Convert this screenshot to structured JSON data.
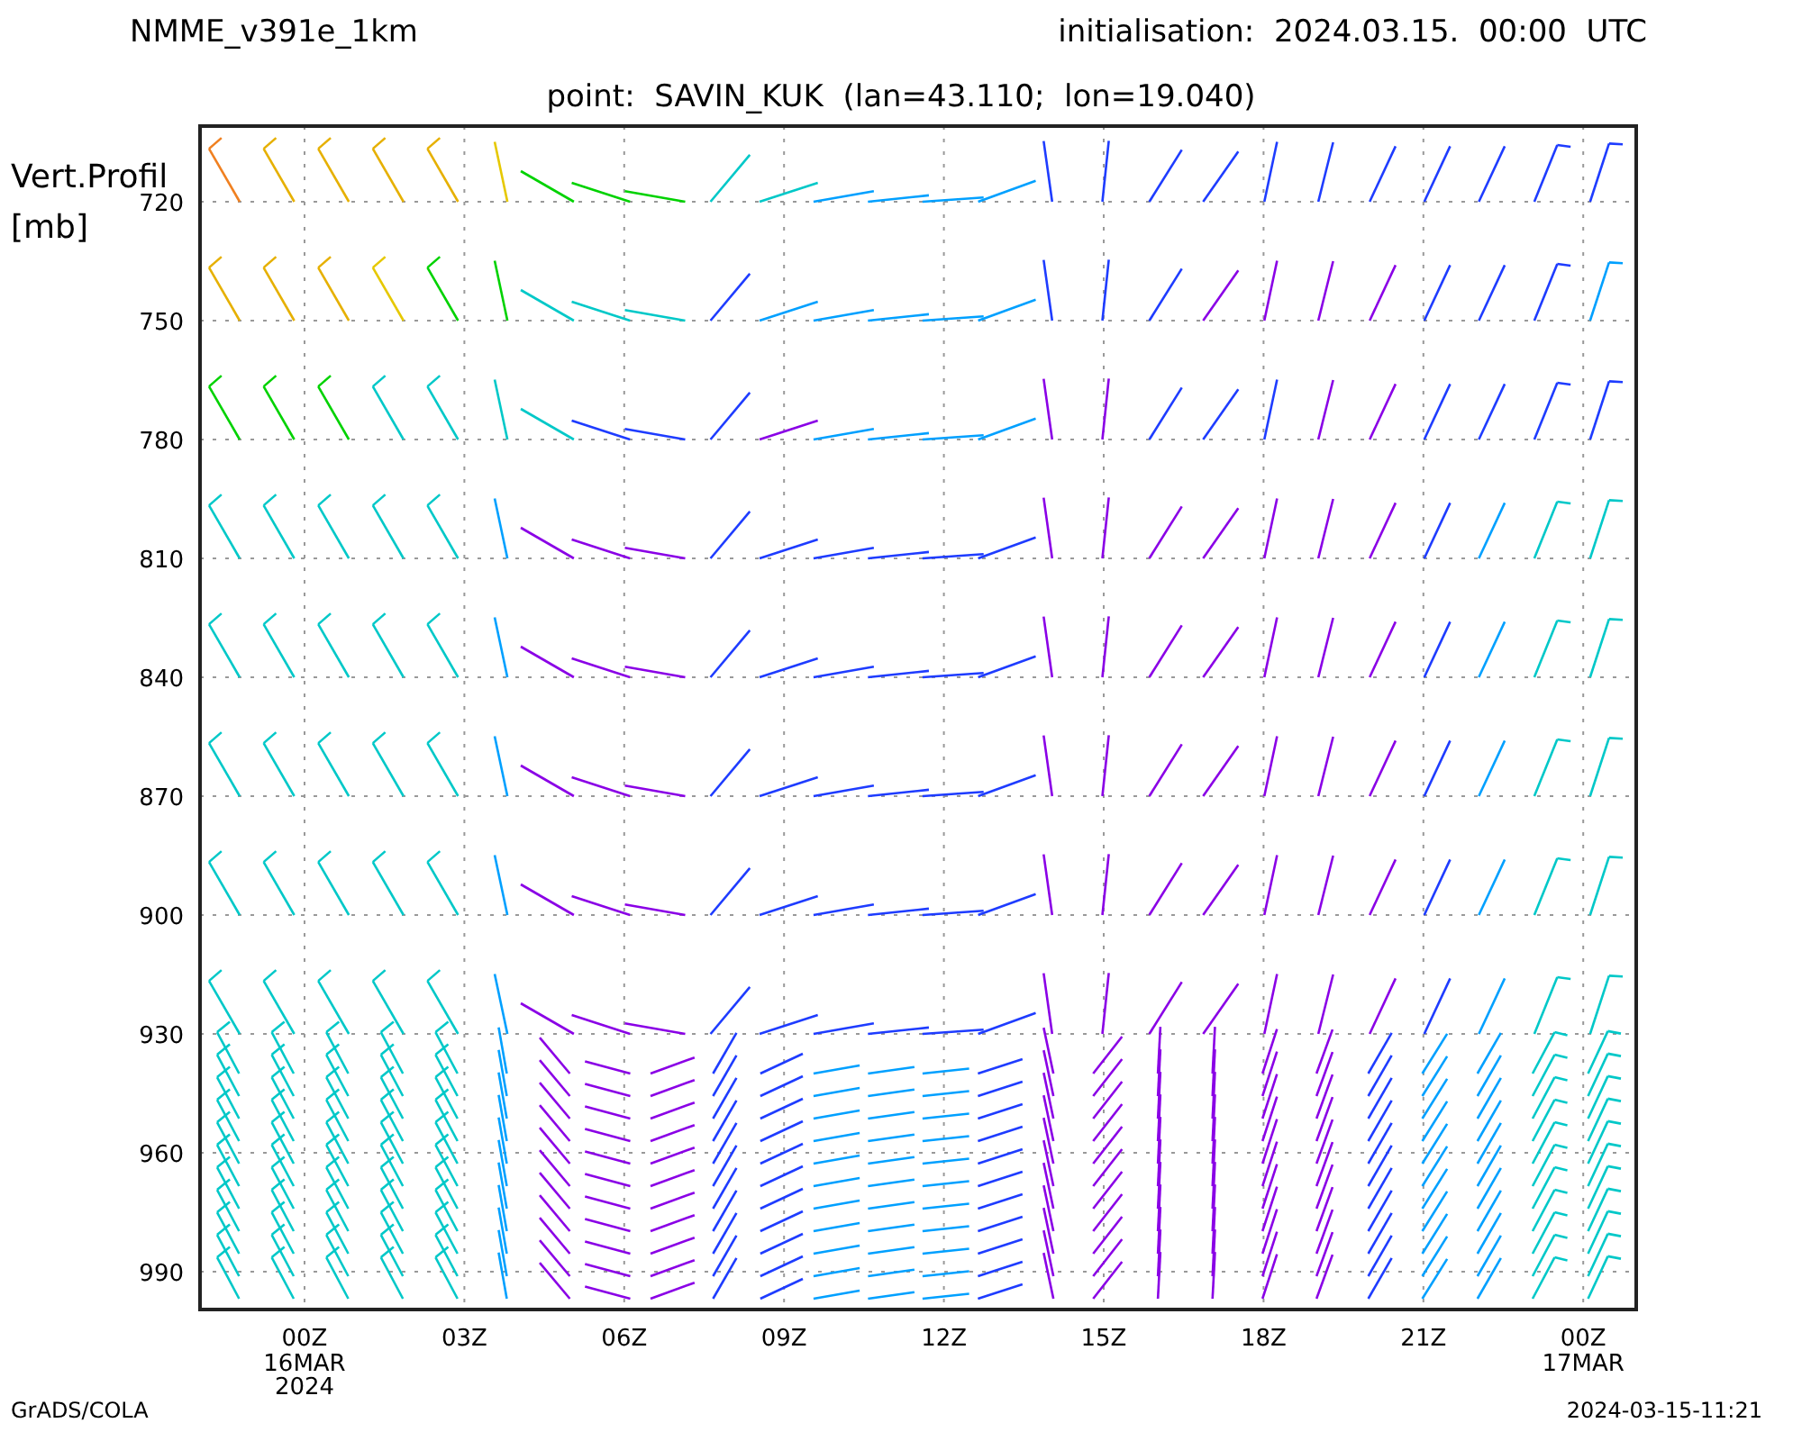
{
  "header": {
    "model": "NMME_v391e_1km",
    "initialisation": "initialisation:  2024.03.15.  00:00  UTC"
  },
  "subtitle": "point:  SAVIN_KUK  (lan=43.110;  lon=19.040)",
  "y_axis": {
    "title": [
      "Vert.Profil",
      "[mb]"
    ],
    "ticks": [
      "720",
      "750",
      "780",
      "810",
      "840",
      "870",
      "900",
      "930",
      "960",
      "990"
    ]
  },
  "x_axis": {
    "ticks": [
      {
        "label": "00Z",
        "sub": [
          "16MAR",
          "2024"
        ]
      },
      {
        "label": "03Z"
      },
      {
        "label": "06Z"
      },
      {
        "label": "09Z"
      },
      {
        "label": "12Z"
      },
      {
        "label": "15Z"
      },
      {
        "label": "18Z"
      },
      {
        "label": "21Z"
      },
      {
        "label": "00Z",
        "sub": [
          "17MAR"
        ]
      }
    ]
  },
  "footer": {
    "left": "GrADS/COLA",
    "right": "2024-03-15-11:21"
  }
}
